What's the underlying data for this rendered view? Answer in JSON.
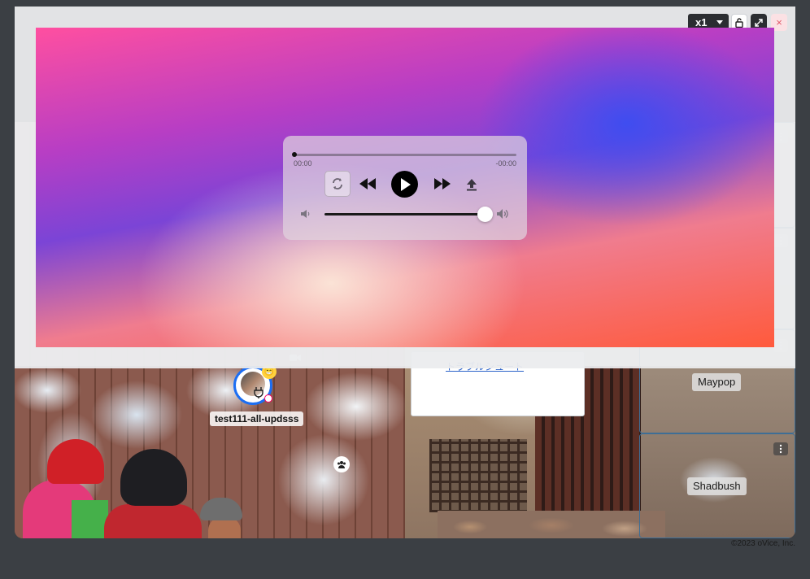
{
  "window": {
    "zoom_label": "x1",
    "close_label": "×"
  },
  "player": {
    "time_elapsed": "00:00",
    "time_remaining": "-00:00",
    "progress": 0.0,
    "volume": 1.0
  },
  "space": {
    "user_name": "test111-all-updsss",
    "emoji": "😁",
    "link_text": "トラブルシュート",
    "labels": [
      "Maypop",
      "Shadbush"
    ],
    "accent_color": "#1b6ef3"
  },
  "footer": {
    "copyright": "©2023 oVice, Inc."
  }
}
